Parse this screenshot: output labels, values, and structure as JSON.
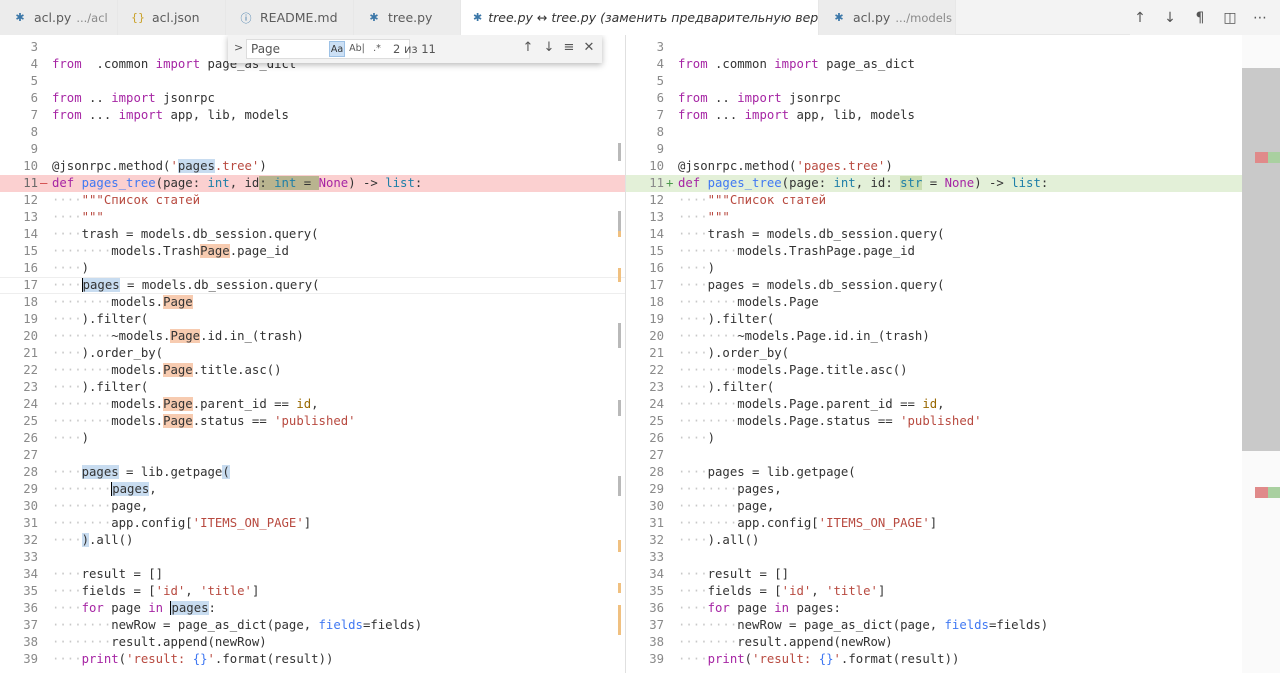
{
  "tabs": [
    {
      "icon": "python-icon",
      "glyph": "✱",
      "cls": "py",
      "label": "acl.py",
      "desc": ".../acl",
      "active": false
    },
    {
      "icon": "json-icon",
      "glyph": "{}",
      "cls": "json",
      "label": "acl.json",
      "desc": "",
      "active": false
    },
    {
      "icon": "info-icon",
      "glyph": "ⓘ",
      "cls": "info",
      "label": "README.md",
      "desc": "",
      "active": false
    },
    {
      "icon": "python-icon",
      "glyph": "✱",
      "cls": "py",
      "label": "tree.py",
      "desc": "",
      "active": false
    },
    {
      "icon": "python-icon",
      "glyph": "✱",
      "cls": "py",
      "label": "tree.py ↔ tree.py (заменить предварительную версию)",
      "desc": "",
      "active": true
    },
    {
      "icon": "python-icon",
      "glyph": "✱",
      "cls": "py",
      "label": "acl.py",
      "desc": ".../models",
      "active": false
    }
  ],
  "actions": {
    "prev": "↑",
    "next": "↓",
    "whitespace": "¶",
    "split": "◫",
    "more": "⋯"
  },
  "find": {
    "toggle": ">",
    "placeholder": "Page",
    "value": "Page",
    "match_case": "Aa",
    "whole_word": "Ab|",
    "regex": ".*",
    "count": "2 из 11",
    "prev": "↑",
    "next": "↓",
    "selection": "≡",
    "close": "✕"
  },
  "left": [
    {
      "n": "3",
      "t": "3",
      "p": []
    },
    {
      "n": "4",
      "t": "",
      "p": [
        [
          "kw",
          "from"
        ],
        [
          "",
          "  .common "
        ],
        [
          "kw",
          "import"
        ],
        [
          "",
          " page_as_dict"
        ]
      ]
    },
    {
      "n": "5",
      "t": "",
      "p": []
    },
    {
      "n": "6",
      "t": "",
      "p": [
        [
          "kw",
          "from"
        ],
        [
          "",
          " .. "
        ],
        [
          "kw",
          "import"
        ],
        [
          "",
          " jsonrpc"
        ]
      ]
    },
    {
      "n": "7",
      "t": "",
      "p": [
        [
          "kw",
          "from"
        ],
        [
          "",
          " ... "
        ],
        [
          "kw",
          "import"
        ],
        [
          "",
          " app, lib, models"
        ]
      ]
    },
    {
      "n": "8",
      "t": "",
      "p": []
    },
    {
      "n": "9",
      "t": "",
      "p": []
    },
    {
      "n": "10",
      "t": "",
      "p": [
        [
          "",
          "@jsonrpc.method("
        ],
        [
          "str",
          "'"
        ],
        [
          "cur-hl",
          "pages"
        ],
        [
          "str",
          ".tree'"
        ],
        [
          "",
          ")"
        ]
      ]
    },
    {
      "n": "11",
      "t": "del",
      "g": "—",
      "p": [
        [
          "kw",
          "def"
        ],
        [
          "",
          " "
        ],
        [
          "fn",
          "pages_tree"
        ],
        [
          "",
          "(page: "
        ],
        [
          "typ",
          "int"
        ],
        [
          "",
          ", id"
        ],
        [
          "chg",
          ": "
        ],
        [
          "chg typ",
          "int"
        ],
        [
          "chg",
          " = "
        ],
        [
          "kw",
          "None"
        ],
        [
          "",
          ") -> "
        ],
        [
          "typ",
          "list"
        ],
        [
          "",
          ":"
        ]
      ]
    },
    {
      "n": "12",
      "t": "",
      "p": [
        [
          "ws",
          "····"
        ],
        [
          "str",
          "\"\"\"Список статей"
        ]
      ]
    },
    {
      "n": "13",
      "t": "",
      "p": [
        [
          "ws",
          "····"
        ],
        [
          "str",
          "\"\"\""
        ]
      ]
    },
    {
      "n": "14",
      "t": "",
      "p": [
        [
          "ws",
          "····"
        ],
        [
          "",
          "trash = models.db_session.query("
        ]
      ]
    },
    {
      "n": "15",
      "t": "",
      "p": [
        [
          "ws",
          "········"
        ],
        [
          "",
          "models.Trash"
        ],
        [
          "hl",
          "Page"
        ],
        [
          "",
          ".page_id"
        ]
      ]
    },
    {
      "n": "16",
      "t": "",
      "p": [
        [
          "ws",
          "····"
        ],
        [
          "",
          ")"
        ]
      ]
    },
    {
      "n": "17",
      "t": "cur",
      "p": [
        [
          "ws",
          "····"
        ],
        [
          "cur-hl caret",
          "pages"
        ],
        [
          "",
          " = models.db_session.query("
        ]
      ]
    },
    {
      "n": "18",
      "t": "",
      "p": [
        [
          "ws",
          "········"
        ],
        [
          "",
          "models."
        ],
        [
          "hl",
          "Page"
        ]
      ]
    },
    {
      "n": "19",
      "t": "",
      "p": [
        [
          "ws",
          "····"
        ],
        [
          "",
          ").filter("
        ]
      ]
    },
    {
      "n": "20",
      "t": "",
      "p": [
        [
          "ws",
          "········"
        ],
        [
          "",
          "~models."
        ],
        [
          "hl",
          "Page"
        ],
        [
          "",
          ".id.in_(trash)"
        ]
      ]
    },
    {
      "n": "21",
      "t": "",
      "p": [
        [
          "ws",
          "····"
        ],
        [
          "",
          ").order_by("
        ]
      ]
    },
    {
      "n": "22",
      "t": "",
      "p": [
        [
          "ws",
          "········"
        ],
        [
          "",
          "models."
        ],
        [
          "hl",
          "Page"
        ],
        [
          "",
          ".title.asc()"
        ]
      ]
    },
    {
      "n": "23",
      "t": "",
      "p": [
        [
          "ws",
          "····"
        ],
        [
          "",
          ").filter("
        ]
      ]
    },
    {
      "n": "24",
      "t": "",
      "p": [
        [
          "ws",
          "········"
        ],
        [
          "",
          "models."
        ],
        [
          "hl",
          "Page"
        ],
        [
          "",
          ".parent_id == "
        ],
        [
          "num",
          "id"
        ],
        [
          "",
          ","
        ]
      ]
    },
    {
      "n": "25",
      "t": "",
      "p": [
        [
          "ws",
          "········"
        ],
        [
          "",
          "models."
        ],
        [
          "hl",
          "Page"
        ],
        [
          "",
          ".status == "
        ],
        [
          "str",
          "'published'"
        ]
      ]
    },
    {
      "n": "26",
      "t": "",
      "p": [
        [
          "ws",
          "····"
        ],
        [
          "",
          ")"
        ]
      ]
    },
    {
      "n": "27",
      "t": "",
      "p": []
    },
    {
      "n": "28",
      "t": "",
      "p": [
        [
          "ws",
          "····"
        ],
        [
          "cur-hl",
          "pages"
        ],
        [
          "",
          " = lib.getpage"
        ],
        [
          "cur-hl",
          "("
        ]
      ]
    },
    {
      "n": "29",
      "t": "",
      "p": [
        [
          "ws",
          "········"
        ],
        [
          "cur-hl caret",
          "pages"
        ],
        [
          "",
          ","
        ]
      ]
    },
    {
      "n": "30",
      "t": "",
      "p": [
        [
          "ws",
          "········"
        ],
        [
          "",
          "page,"
        ]
      ]
    },
    {
      "n": "31",
      "t": "",
      "p": [
        [
          "ws",
          "········"
        ],
        [
          "",
          "app.config["
        ],
        [
          "str",
          "'ITEMS_ON_PAGE'"
        ],
        [
          "",
          "]"
        ]
      ]
    },
    {
      "n": "32",
      "t": "",
      "p": [
        [
          "ws",
          "····"
        ],
        [
          "cur-hl",
          ")"
        ],
        [
          ".all()",
          ".all()"
        ]
      ]
    },
    {
      "n": "33",
      "t": "",
      "p": []
    },
    {
      "n": "34",
      "t": "",
      "p": [
        [
          "ws",
          "····"
        ],
        [
          "",
          "result = []"
        ]
      ]
    },
    {
      "n": "35",
      "t": "",
      "p": [
        [
          "ws",
          "····"
        ],
        [
          "",
          "fields = ["
        ],
        [
          "str",
          "'id'"
        ],
        [
          "",
          ", "
        ],
        [
          "str",
          "'title'"
        ],
        [
          "",
          "]"
        ]
      ]
    },
    {
      "n": "36",
      "t": "",
      "p": [
        [
          "ws",
          "····"
        ],
        [
          "kw",
          "for"
        ],
        [
          "",
          " page "
        ],
        [
          "kw",
          "in"
        ],
        [
          "",
          " "
        ],
        [
          "cur-hl caret",
          "pages"
        ],
        [
          "",
          ":"
        ]
      ]
    },
    {
      "n": "37",
      "t": "",
      "p": [
        [
          "ws",
          "········"
        ],
        [
          "",
          "newRow = page_as_dict(page, "
        ],
        [
          "fn",
          "fields"
        ],
        [
          "",
          "=fields)"
        ]
      ]
    },
    {
      "n": "38",
      "t": "",
      "p": [
        [
          "ws",
          "········"
        ],
        [
          "",
          "result.append(newRow)"
        ]
      ]
    },
    {
      "n": "39",
      "t": "",
      "p": [
        [
          "ws",
          "····"
        ],
        [
          "kw",
          "print"
        ],
        [
          "",
          "("
        ],
        [
          "str",
          "'result: "
        ],
        [
          "fn",
          "{}"
        ],
        [
          "str",
          "'"
        ],
        [
          "",
          ".format(result))"
        ]
      ]
    }
  ],
  "right": [
    {
      "n": "3",
      "t": "",
      "p": []
    },
    {
      "n": "4",
      "t": "",
      "p": [
        [
          "kw",
          "from"
        ],
        [
          "",
          " .common "
        ],
        [
          "kw",
          "import"
        ],
        [
          "",
          " page_as_dict"
        ]
      ]
    },
    {
      "n": "5",
      "t": "",
      "p": []
    },
    {
      "n": "6",
      "t": "",
      "p": [
        [
          "kw",
          "from"
        ],
        [
          "",
          " .. "
        ],
        [
          "kw",
          "import"
        ],
        [
          "",
          " jsonrpc"
        ]
      ]
    },
    {
      "n": "7",
      "t": "",
      "p": [
        [
          "kw",
          "from"
        ],
        [
          "",
          " ... "
        ],
        [
          "kw",
          "import"
        ],
        [
          "",
          " app, lib, models"
        ]
      ]
    },
    {
      "n": "8",
      "t": "",
      "p": []
    },
    {
      "n": "9",
      "t": "",
      "p": []
    },
    {
      "n": "10",
      "t": "",
      "p": [
        [
          "",
          "@jsonrpc.method("
        ],
        [
          "str",
          "'pages.tree'"
        ],
        [
          "",
          ")"
        ]
      ]
    },
    {
      "n": "11",
      "t": "ins",
      "g": "+",
      "p": [
        [
          "kw",
          "def"
        ],
        [
          "",
          " "
        ],
        [
          "fn",
          "pages_tree"
        ],
        [
          "",
          "(page: "
        ],
        [
          "typ",
          "int"
        ],
        [
          "",
          ", id: "
        ],
        [
          "chg2 typ",
          "str"
        ],
        [
          "",
          " = "
        ],
        [
          "kw",
          "None"
        ],
        [
          "",
          ") -> "
        ],
        [
          "typ",
          "list"
        ],
        [
          "",
          ":"
        ]
      ]
    },
    {
      "n": "12",
      "t": "",
      "p": [
        [
          "ws",
          "····"
        ],
        [
          "str",
          "\"\"\"Список статей"
        ]
      ]
    },
    {
      "n": "13",
      "t": "",
      "p": [
        [
          "ws",
          "····"
        ],
        [
          "str",
          "\"\"\""
        ]
      ]
    },
    {
      "n": "14",
      "t": "",
      "p": [
        [
          "ws",
          "····"
        ],
        [
          "",
          "trash = models.db_session.query("
        ]
      ]
    },
    {
      "n": "15",
      "t": "",
      "p": [
        [
          "ws",
          "········"
        ],
        [
          "",
          "models.TrashPage.page_id"
        ]
      ]
    },
    {
      "n": "16",
      "t": "",
      "p": [
        [
          "ws",
          "····"
        ],
        [
          "",
          ")"
        ]
      ]
    },
    {
      "n": "17",
      "t": "",
      "p": [
        [
          "ws",
          "····"
        ],
        [
          "",
          "pages = models.db_session.query("
        ]
      ]
    },
    {
      "n": "18",
      "t": "",
      "p": [
        [
          "ws",
          "········"
        ],
        [
          "",
          "models.Page"
        ]
      ]
    },
    {
      "n": "19",
      "t": "",
      "p": [
        [
          "ws",
          "····"
        ],
        [
          "",
          ").filter("
        ]
      ]
    },
    {
      "n": "20",
      "t": "",
      "p": [
        [
          "ws",
          "········"
        ],
        [
          "",
          "~models.Page.id.in_(trash)"
        ]
      ]
    },
    {
      "n": "21",
      "t": "",
      "p": [
        [
          "ws",
          "····"
        ],
        [
          "",
          ").order_by("
        ]
      ]
    },
    {
      "n": "22",
      "t": "",
      "p": [
        [
          "ws",
          "········"
        ],
        [
          "",
          "models.Page.title.asc()"
        ]
      ]
    },
    {
      "n": "23",
      "t": "",
      "p": [
        [
          "ws",
          "····"
        ],
        [
          "",
          ").filter("
        ]
      ]
    },
    {
      "n": "24",
      "t": "",
      "p": [
        [
          "ws",
          "········"
        ],
        [
          "",
          "models.Page.parent_id == "
        ],
        [
          "num",
          "id"
        ],
        [
          "",
          ","
        ]
      ]
    },
    {
      "n": "25",
      "t": "",
      "p": [
        [
          "ws",
          "········"
        ],
        [
          "",
          "models.Page.status == "
        ],
        [
          "str",
          "'published'"
        ]
      ]
    },
    {
      "n": "26",
      "t": "",
      "p": [
        [
          "ws",
          "····"
        ],
        [
          "",
          ")"
        ]
      ]
    },
    {
      "n": "27",
      "t": "",
      "p": []
    },
    {
      "n": "28",
      "t": "",
      "p": [
        [
          "ws",
          "····"
        ],
        [
          "",
          "pages = lib.getpage("
        ]
      ]
    },
    {
      "n": "29",
      "t": "",
      "p": [
        [
          "ws",
          "········"
        ],
        [
          "",
          "pages,"
        ]
      ]
    },
    {
      "n": "30",
      "t": "",
      "p": [
        [
          "ws",
          "········"
        ],
        [
          "",
          "page,"
        ]
      ]
    },
    {
      "n": "31",
      "t": "",
      "p": [
        [
          "ws",
          "········"
        ],
        [
          "",
          "app.config["
        ],
        [
          "str",
          "'ITEMS_ON_PAGE'"
        ],
        [
          "",
          "]"
        ]
      ]
    },
    {
      "n": "32",
      "t": "",
      "p": [
        [
          "ws",
          "····"
        ],
        [
          "",
          ").all()"
        ]
      ]
    },
    {
      "n": "33",
      "t": "",
      "p": []
    },
    {
      "n": "34",
      "t": "",
      "p": [
        [
          "ws",
          "····"
        ],
        [
          "",
          "result = []"
        ]
      ]
    },
    {
      "n": "35",
      "t": "",
      "p": [
        [
          "ws",
          "····"
        ],
        [
          "",
          "fields = ["
        ],
        [
          "str",
          "'id'"
        ],
        [
          "",
          ", "
        ],
        [
          "str",
          "'title'"
        ],
        [
          "",
          "]"
        ]
      ]
    },
    {
      "n": "36",
      "t": "",
      "p": [
        [
          "ws",
          "····"
        ],
        [
          "kw",
          "for"
        ],
        [
          "",
          " page "
        ],
        [
          "kw",
          "in"
        ],
        [
          "",
          " pages:"
        ]
      ]
    },
    {
      "n": "37",
      "t": "",
      "p": [
        [
          "ws",
          "········"
        ],
        [
          "",
          "newRow = page_as_dict(page, "
        ],
        [
          "fn",
          "fields"
        ],
        [
          "",
          "=fields)"
        ]
      ]
    },
    {
      "n": "38",
      "t": "",
      "p": [
        [
          "ws",
          "········"
        ],
        [
          "",
          "result.append(newRow)"
        ]
      ]
    },
    {
      "n": "39",
      "t": "",
      "p": [
        [
          "ws",
          "····"
        ],
        [
          "kw",
          "print"
        ],
        [
          "",
          "("
        ],
        [
          "str",
          "'result: "
        ],
        [
          "fn",
          "{}"
        ],
        [
          "str",
          "'"
        ],
        [
          "",
          ".format(result))"
        ]
      ]
    }
  ],
  "colors": {
    "deleted": "#fbd0d0",
    "inserted": "#e3f0d8",
    "match": "#f7cbb0",
    "cursor_match": "#c8dcf0"
  }
}
